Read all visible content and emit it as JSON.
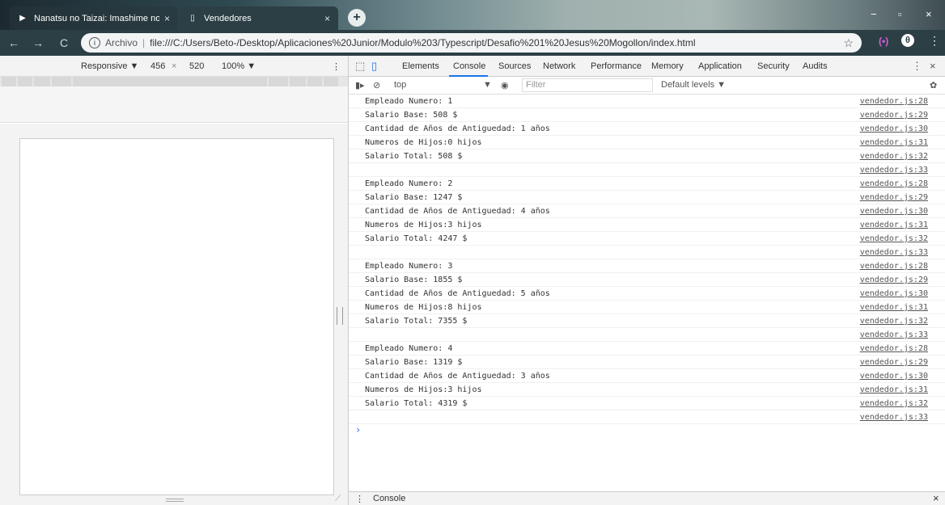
{
  "browser": {
    "tabs": [
      {
        "title": "Nanatsu no Taizai: Imashime no F",
        "close": "×"
      },
      {
        "title": "Vendedores",
        "close": "×"
      }
    ],
    "new_tab": "+",
    "window_controls": [
      "−",
      "▫",
      "×"
    ],
    "nav": {
      "back": "←",
      "forward": "→",
      "reload": "C"
    },
    "address": {
      "info": "i",
      "scheme": "Archivo",
      "separator": "|",
      "url": "file:///C:/Users/Beto-/Desktop/Aplicaciones%20Junior/Modulo%203/Typescript/Desafio%201%20Jesus%20Mogollon/index.html",
      "bookmark": "☆"
    },
    "extension": "(•)",
    "profile": "θ",
    "menu": "⋮"
  },
  "device_toolbar": {
    "mode": "Responsive ▼",
    "width": "456",
    "times": "×",
    "height": "520",
    "zoom": "100% ▼",
    "more": "⋮"
  },
  "devtools": {
    "icons": {
      "inspect": "⬚",
      "device": "▯"
    },
    "tabs": [
      "Elements",
      "Console",
      "Sources",
      "Network",
      "Performance",
      "Memory",
      "Application",
      "Security",
      "Audits"
    ],
    "active_tab": "Console",
    "more": "⋮",
    "close": "×",
    "filter_bar": {
      "sidebar_icon": "▮▸",
      "clear_icon": "⊘",
      "context": "top",
      "context_arrow": "▼",
      "eye_icon": "◉",
      "filter_placeholder": "Filter",
      "levels": "Default levels ▼",
      "settings_icon": "✿"
    },
    "console_lines": [
      {
        "msg": "Empleado Numero: 1",
        "src": "vendedor.js:28"
      },
      {
        "msg": "Salario Base: 508 $",
        "src": "vendedor.js:29"
      },
      {
        "msg": "Cantidad de Años de Antiguedad: 1 años",
        "src": "vendedor.js:30"
      },
      {
        "msg": "Numeros de Hijos:0 hijos",
        "src": "vendedor.js:31"
      },
      {
        "msg": "Salario Total: 508 $",
        "src": "vendedor.js:32"
      },
      {
        "msg": "",
        "src": "vendedor.js:33"
      },
      {
        "msg": "Empleado Numero: 2",
        "src": "vendedor.js:28"
      },
      {
        "msg": "Salario Base: 1247 $",
        "src": "vendedor.js:29"
      },
      {
        "msg": "Cantidad de Años de Antiguedad: 4 años",
        "src": "vendedor.js:30"
      },
      {
        "msg": "Numeros de Hijos:3 hijos",
        "src": "vendedor.js:31"
      },
      {
        "msg": "Salario Total: 4247 $",
        "src": "vendedor.js:32"
      },
      {
        "msg": "",
        "src": "vendedor.js:33"
      },
      {
        "msg": "Empleado Numero: 3",
        "src": "vendedor.js:28"
      },
      {
        "msg": "Salario Base: 1855 $",
        "src": "vendedor.js:29"
      },
      {
        "msg": "Cantidad de Años de Antiguedad: 5 años",
        "src": "vendedor.js:30"
      },
      {
        "msg": "Numeros de Hijos:8 hijos",
        "src": "vendedor.js:31"
      },
      {
        "msg": "Salario Total: 7355 $",
        "src": "vendedor.js:32"
      },
      {
        "msg": "",
        "src": "vendedor.js:33"
      },
      {
        "msg": "Empleado Numero: 4",
        "src": "vendedor.js:28"
      },
      {
        "msg": "Salario Base: 1319 $",
        "src": "vendedor.js:29"
      },
      {
        "msg": "Cantidad de Años de Antiguedad: 3 años",
        "src": "vendedor.js:30"
      },
      {
        "msg": "Numeros de Hijos:3 hijos",
        "src": "vendedor.js:31"
      },
      {
        "msg": "Salario Total: 4319 $",
        "src": "vendedor.js:32"
      },
      {
        "msg": "",
        "src": "vendedor.js:33"
      }
    ],
    "prompt": "›",
    "drawer": {
      "menu": "⋮",
      "label": "Console",
      "close": "×"
    }
  },
  "colors": {
    "accent": "#1a73e8",
    "chrome_frame": "#2b3f45"
  }
}
